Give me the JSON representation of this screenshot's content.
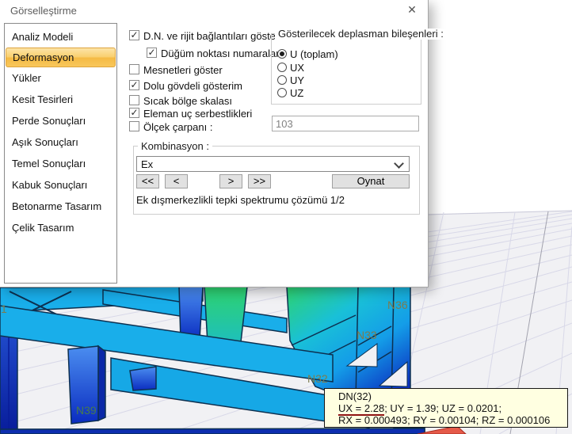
{
  "icons": {
    "close": "✕",
    "check": "✓",
    "chevron_down": "v"
  },
  "dialog": {
    "title": "Görselleştirme",
    "sidebar": {
      "items": [
        {
          "label": "Analiz Modeli",
          "selected": false
        },
        {
          "label": "Deformasyon",
          "selected": true
        },
        {
          "label": "Yükler",
          "selected": false
        },
        {
          "label": "Kesit Tesirleri",
          "selected": false
        },
        {
          "label": "Perde Sonuçları",
          "selected": false
        },
        {
          "label": "Aşık Sonuçları",
          "selected": false
        },
        {
          "label": "Temel Sonuçları",
          "selected": false
        },
        {
          "label": "Kabuk Sonuçları",
          "selected": false
        },
        {
          "label": "Betonarme Tasarım",
          "selected": false
        },
        {
          "label": "Çelik Tasarım",
          "selected": false
        }
      ]
    },
    "checkboxes": [
      {
        "label": "D.N. ve rijit bağlantıları göster",
        "checked": true,
        "indent": false
      },
      {
        "label": "Düğüm noktası numaraları",
        "checked": true,
        "indent": true
      },
      {
        "label": "Mesnetleri göster",
        "checked": false,
        "indent": false
      },
      {
        "label": "Dolu gövdeli gösterim",
        "checked": true,
        "indent": false
      },
      {
        "label": "Sıcak bölge skalası",
        "checked": false,
        "indent": false
      },
      {
        "label": "Eleman uç serbestlikleri",
        "checked": true,
        "indent": false
      },
      {
        "label": "Ölçek çarpanı :",
        "checked": false,
        "indent": false
      }
    ],
    "scale_input": {
      "value": "103",
      "enabled": false
    },
    "displacement_group": {
      "title": "Gösterilecek deplasman bileşenleri :",
      "options": [
        {
          "label": "U (toplam)",
          "selected": true
        },
        {
          "label": "UX",
          "selected": false
        },
        {
          "label": "UY",
          "selected": false
        },
        {
          "label": "UZ",
          "selected": false
        }
      ]
    },
    "combination_group": {
      "title": "Kombinasyon :",
      "selected_combination": "Ex",
      "buttons": {
        "first": "<<",
        "prev": "<",
        "next": ">",
        "last": ">>",
        "play": "Oynat"
      },
      "status": "Ek dışmerkezlikli tepki spektrumu çözümü 1/2"
    }
  },
  "viewport": {
    "node_labels": [
      "N36",
      "N33",
      "N32",
      "N39",
      "1"
    ],
    "tooltip": {
      "title": "DN(32)",
      "ux_highlight": "UX = 2.28",
      "line2_rest": "; UY = 1.39; UZ = 0.0201;",
      "line3": "RX = 0.000493; RY = 0.00104; RZ = 0.000106"
    },
    "colors": {
      "beam_cyan": "#19aeea",
      "column_blue": "#0d2fb6",
      "deform_green": "#2ed36e",
      "node_label": "#7c7c4f",
      "tooltip_bg": "#ffffe1",
      "underline_red": "#8f1212",
      "selected_item_orange": "#f5ba44"
    }
  }
}
